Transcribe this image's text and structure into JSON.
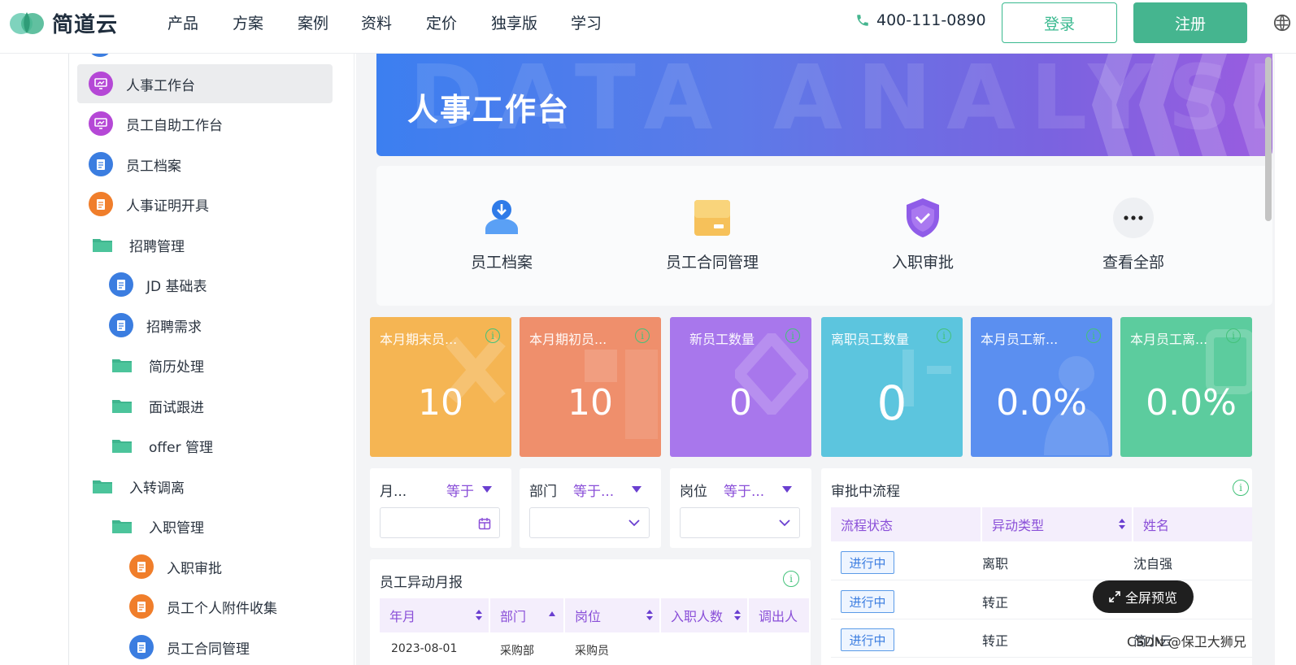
{
  "brand": {
    "name": "简道云",
    "colors": {
      "green": "#45b58f",
      "purple": "#8a4fd8"
    }
  },
  "nav": {
    "items": [
      "产品",
      "方案",
      "案例",
      "资料",
      "定价",
      "独享版",
      "学习"
    ],
    "phone": "400-111-0890",
    "login_label": "登录",
    "register_label": "注册"
  },
  "sidebar": {
    "items": [
      {
        "label": "人事工作台",
        "icon": "dashboard-icon",
        "active": true
      },
      {
        "label": "员工自助工作台",
        "icon": "dashboard-icon"
      },
      {
        "label": "员工档案",
        "icon": "document-icon"
      },
      {
        "label": "人事证明开具",
        "icon": "document-icon"
      },
      {
        "label": "招聘管理",
        "icon": "folder-icon"
      },
      {
        "label": "JD 基础表",
        "icon": "document-icon"
      },
      {
        "label": "招聘需求",
        "icon": "document-icon"
      },
      {
        "label": "简历处理",
        "icon": "folder-icon"
      },
      {
        "label": "面试跟进",
        "icon": "folder-icon"
      },
      {
        "label": "offer 管理",
        "icon": "folder-icon"
      },
      {
        "label": "入转调离",
        "icon": "folder-icon"
      },
      {
        "label": "入职管理",
        "icon": "folder-icon"
      },
      {
        "label": "入职审批",
        "icon": "document-icon"
      },
      {
        "label": "员工个人附件收集",
        "icon": "document-icon"
      },
      {
        "label": "员工合同管理",
        "icon": "document-icon"
      }
    ]
  },
  "banner": {
    "title": "人事工作台",
    "background_text": "DATA ANALYSIS"
  },
  "shortcuts": [
    {
      "label": "员工档案",
      "icon": "employee-download-icon"
    },
    {
      "label": "员工合同管理",
      "icon": "contract-box-icon"
    },
    {
      "label": "入职审批",
      "icon": "shield-check-icon"
    },
    {
      "label": "查看全部",
      "icon": "more-icon"
    }
  ],
  "kpis": [
    {
      "title": "本月期末员...",
      "value": "10",
      "color": "#f5b553"
    },
    {
      "title": "本月期初员...",
      "value": "10",
      "color": "#ef8f6c"
    },
    {
      "title": "新员工数量",
      "value": "0",
      "color": "#a877ec"
    },
    {
      "title": "离职员工数量",
      "value": "0",
      "color": "#5cc5de"
    },
    {
      "title": "本月员工新...",
      "value": "0.0%",
      "color": "#5b8ff0"
    },
    {
      "title": "本月员工离...",
      "value": "0.0%",
      "color": "#5ccc9e"
    }
  ],
  "filters": [
    {
      "label": "月...",
      "op": "等于"
    },
    {
      "label": "部门",
      "op": "等于..."
    },
    {
      "label": "岗位",
      "op": "等于..."
    }
  ],
  "report": {
    "title": "员工异动月报",
    "columns": [
      "年月",
      "部门",
      "岗位",
      "入职人数",
      "调出人"
    ],
    "row": [
      "2023-08-01",
      "采购部",
      "采购员"
    ]
  },
  "approval": {
    "title": "审批中流程",
    "columns": [
      "流程状态",
      "异动类型",
      "姓名"
    ],
    "rows": [
      {
        "status": "进行中",
        "type": "离职",
        "name": "沈自强"
      },
      {
        "status": "进行中",
        "type": "转正",
        "name": ""
      },
      {
        "status": "进行中",
        "type": "转正",
        "name": "简小云"
      }
    ]
  },
  "fullscreen_label": "全屏预览",
  "watermark": "CSDN @保卫大狮兄"
}
